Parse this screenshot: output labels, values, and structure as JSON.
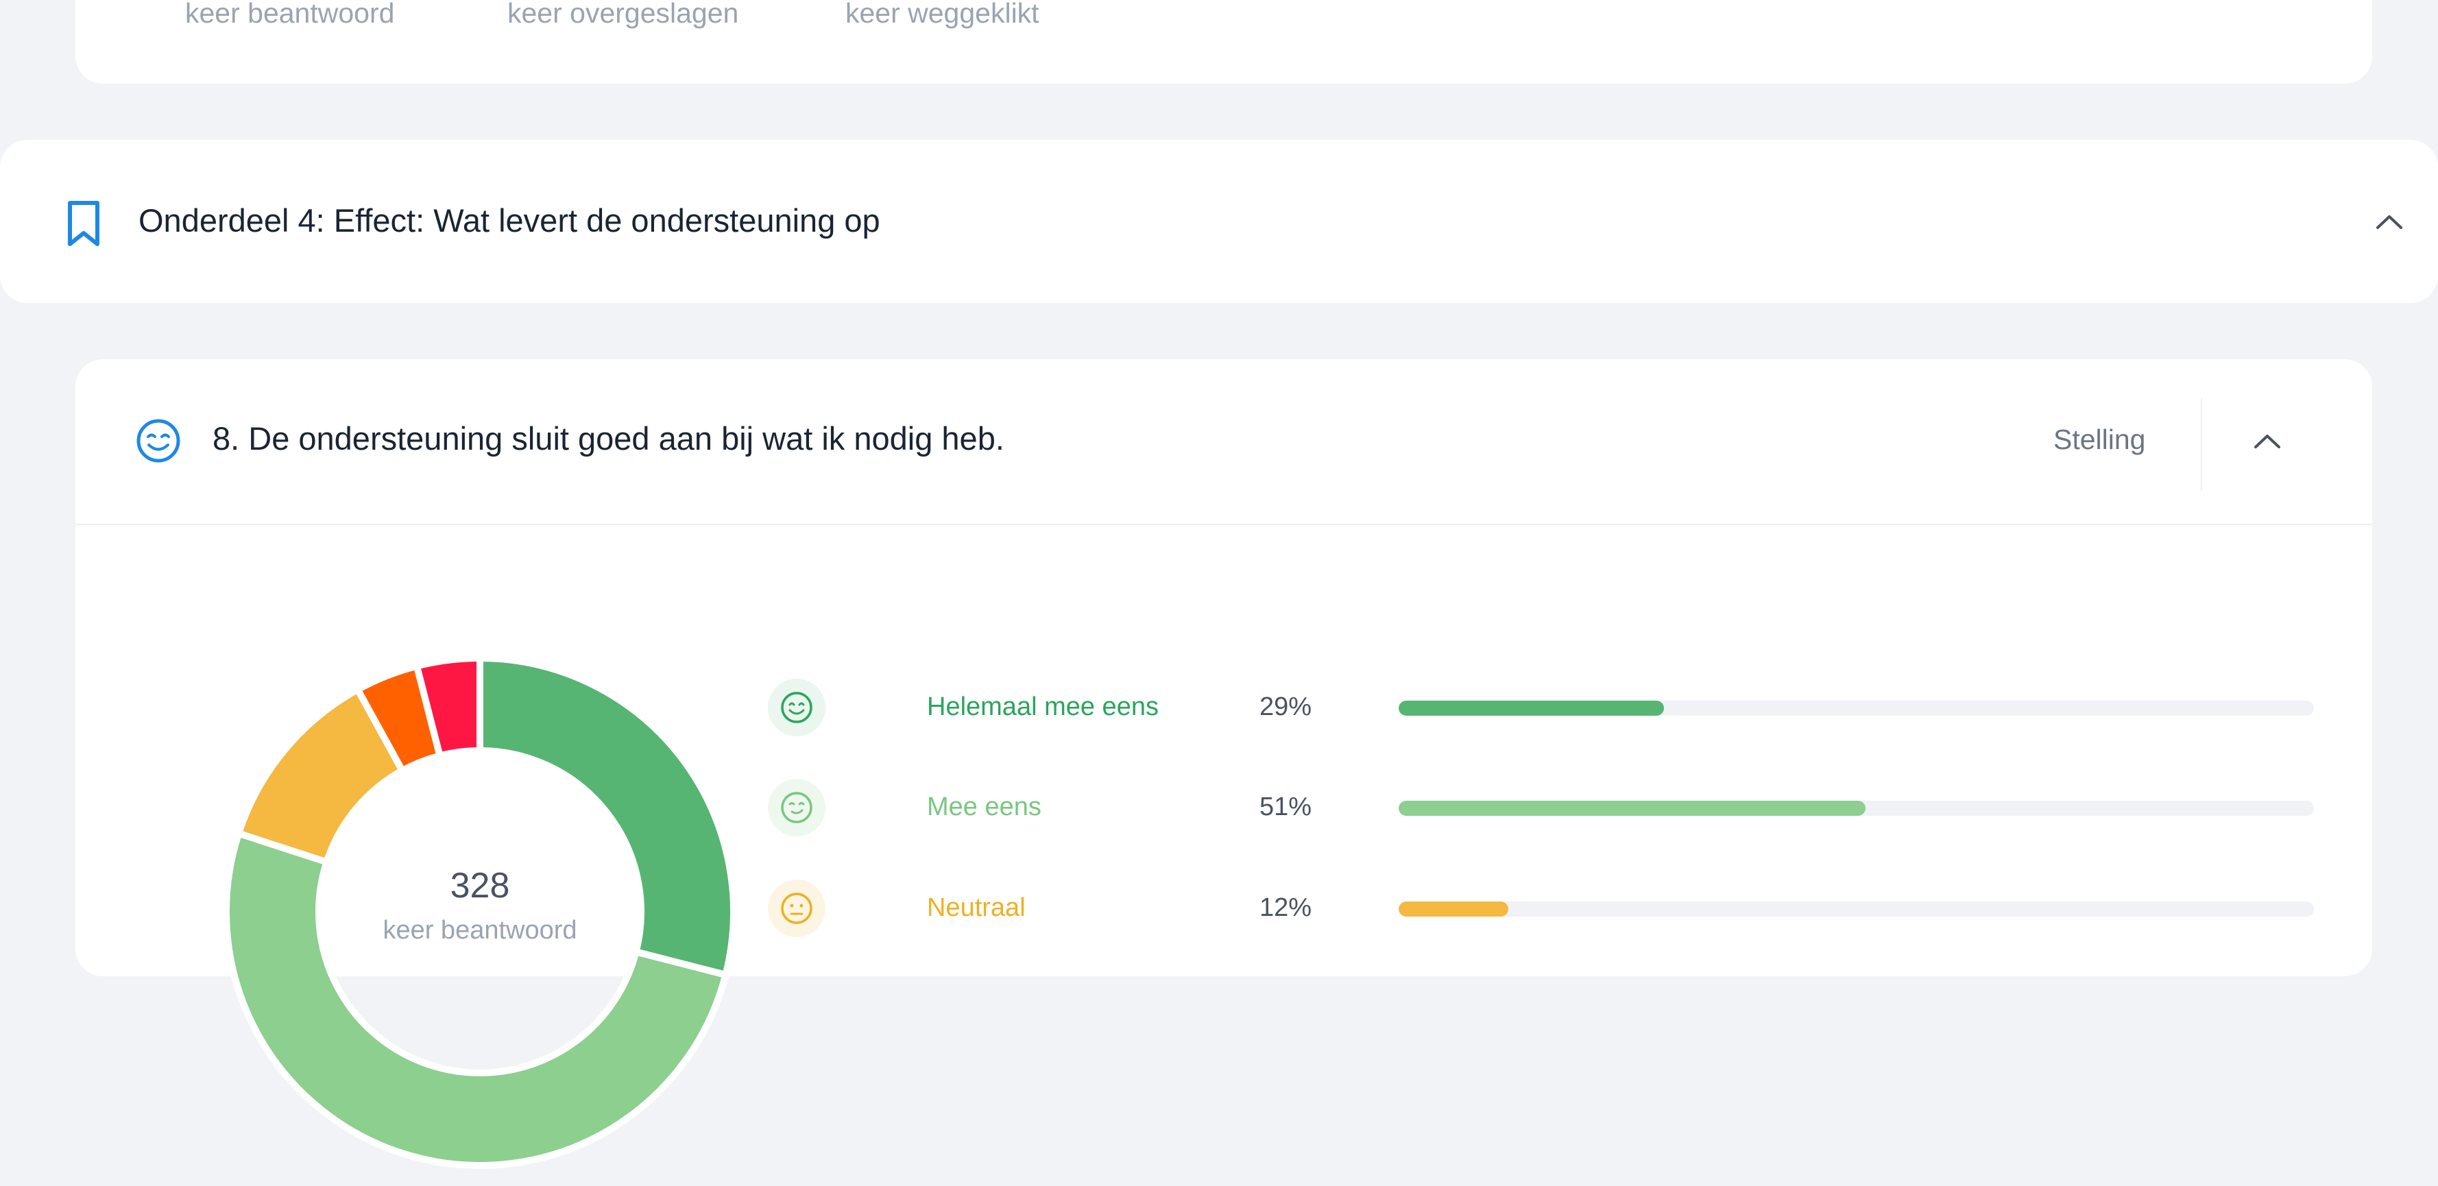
{
  "top_card": {
    "stats": [
      {
        "label": "keer beantwoord"
      },
      {
        "label": "keer overgeslagen"
      },
      {
        "label": "keer weggeklikt"
      }
    ]
  },
  "section": {
    "title": "Onderdeel 4: Effect: Wat levert de ondersteuning op",
    "icon": "bookmark-icon",
    "toggle_icon": "chevron-up-icon"
  },
  "question": {
    "title": "8. De ondersteuning sluit goed aan bij wat ik nodig heb.",
    "type": "Stelling",
    "icon": "smiley-icon",
    "toggle_icon": "chevron-up-icon"
  },
  "answers": [
    {
      "label": "Helemaal mee eens",
      "percent": "29%",
      "value": 29,
      "color": "#56b572",
      "label_color": "#2aa55c",
      "icon": "very-happy-face-icon",
      "icon_bg": "#eaf6ee"
    },
    {
      "label": "Mee eens",
      "percent": "51%",
      "value": 51,
      "color": "#8ccf8f",
      "label_color": "#79c77f",
      "icon": "happy-face-icon",
      "icon_bg": "#eff8ef"
    },
    {
      "label": "Neutraal",
      "percent": "12%",
      "value": 12,
      "color": "#f5b840",
      "label_color": "#efb021",
      "icon": "neutral-face-icon",
      "icon_bg": "#fdf5e3"
    }
  ],
  "chart_data": {
    "type": "pie",
    "center_value": "328",
    "center_label": "keer beantwoord",
    "slices": [
      {
        "name": "Helemaal mee eens",
        "value": 29,
        "color": "#56b572"
      },
      {
        "name": "Mee eens",
        "value": 51,
        "color": "#8ccf8f"
      },
      {
        "name": "Neutraal",
        "value": 12,
        "color": "#f5b840"
      },
      {
        "value": 4,
        "color": "#ff6100"
      },
      {
        "value": 4,
        "color": "#ff1744"
      }
    ]
  }
}
